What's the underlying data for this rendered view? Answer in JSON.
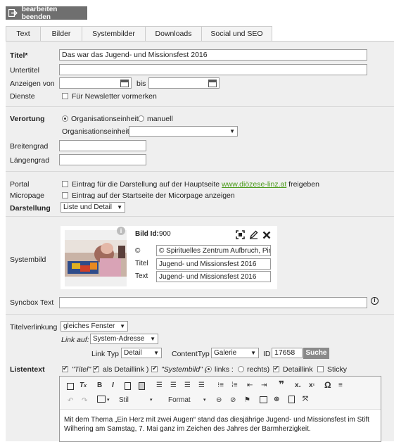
{
  "top_button": {
    "label": "bearbeiten beenden",
    "icon": "exit-icon"
  },
  "tabs": [
    {
      "label": "Text",
      "active": true
    },
    {
      "label": "Bilder"
    },
    {
      "label": "Systembilder"
    },
    {
      "label": "Downloads"
    },
    {
      "label": "Social und SEO"
    }
  ],
  "fields": {
    "titel_label": "Titel*",
    "titel_value": "Das war das Jugend- und Missionsfest 2016",
    "untertitel_label": "Untertitel",
    "untertitel_value": "",
    "anzeigen_von_label": "Anzeigen von",
    "bis_label": "bis",
    "dienste_label": "Dienste",
    "newsletter_label": "Für Newsletter vormerken"
  },
  "verortung": {
    "label": "Verortung",
    "option_org": "Organisationseinheit",
    "option_manuell": "manuell",
    "org_label": "Organisationseinheit",
    "org_value": "",
    "breitengrad_label": "Breitengrad",
    "laengengrad_label": "Längengrad"
  },
  "portal": {
    "portal_label": "Portal",
    "portal_text_pre": "Eintrag für die Darstellung auf der Hauptseite",
    "portal_link": "www.diözese-linz.at",
    "portal_text_post": "freigeben",
    "micropage_label": "Micropage",
    "micropage_text": "Eintrag auf der Startseite der Micorpage anzeigen",
    "darstellung_label": "Darstellung",
    "darstellung_value": "Liste und Detail"
  },
  "systembild": {
    "label": "Systembild",
    "bild_id_label": "Bild Id:",
    "bild_id_value": "900",
    "copyright_label": "©",
    "copyright_value": "© Spirituelles Zentrum Aufbruch, Pin",
    "titel_label": "Titel",
    "titel_value": "Jugend- und Missionsfest 2016",
    "text_label": "Text",
    "text_value": "Jugend- und Missionsfest 2016",
    "info_icon": "info-icon",
    "focus_icon": "focus-icon",
    "edit_icon": "pencil-icon",
    "close_icon": "close-icon"
  },
  "syncbox": {
    "label": "Syncbox Text",
    "value": "",
    "info_icon": "info-icon"
  },
  "verlinkung": {
    "label": "Titelverlinkung",
    "fenster_value": "gleiches Fenster",
    "link_auf_label": "Link auf:",
    "link_auf_value": "System-Adresse",
    "link_typ_label": "Link Typ",
    "link_typ_value": "Detail",
    "content_typ_label": "ContentTyp",
    "content_typ_value": "Galerie",
    "id_label": "ID",
    "id_value": "17658",
    "suche_label": "Suche"
  },
  "listentext": {
    "label": "Listentext",
    "titel_cb": "\"Titel\" (",
    "als_detaillink": "als Detaillink )",
    "systembild_cb": "\"Systembild\" (",
    "links": "links :",
    "rechts": "rechts)",
    "detaillink": "Detaillink",
    "sticky": "Sticky",
    "toolbar_row1": [
      "save-icon",
      "clear-format-icon",
      "B",
      "I",
      "paste-icon",
      "paste-text-icon",
      "align-left-icon",
      "align-center-icon",
      "align-right-icon",
      "align-justify-icon",
      "bullet-list-icon",
      "numbered-list-icon",
      "outdent-icon",
      "indent-icon",
      "quote-icon",
      "subscript-icon",
      "superscript-icon",
      "omega-icon",
      "hr-icon"
    ],
    "toolbar_stil": "Stil",
    "toolbar_format": "Format",
    "content": "Mit dem Thema „Ein Herz mit zwei Augen“ stand das diesjährige Jugend- und Missionsfest im Stift Wilhering am Samstag, 7. Mai ganz im Zeichen des Jahres der Barmherzigkeit."
  }
}
